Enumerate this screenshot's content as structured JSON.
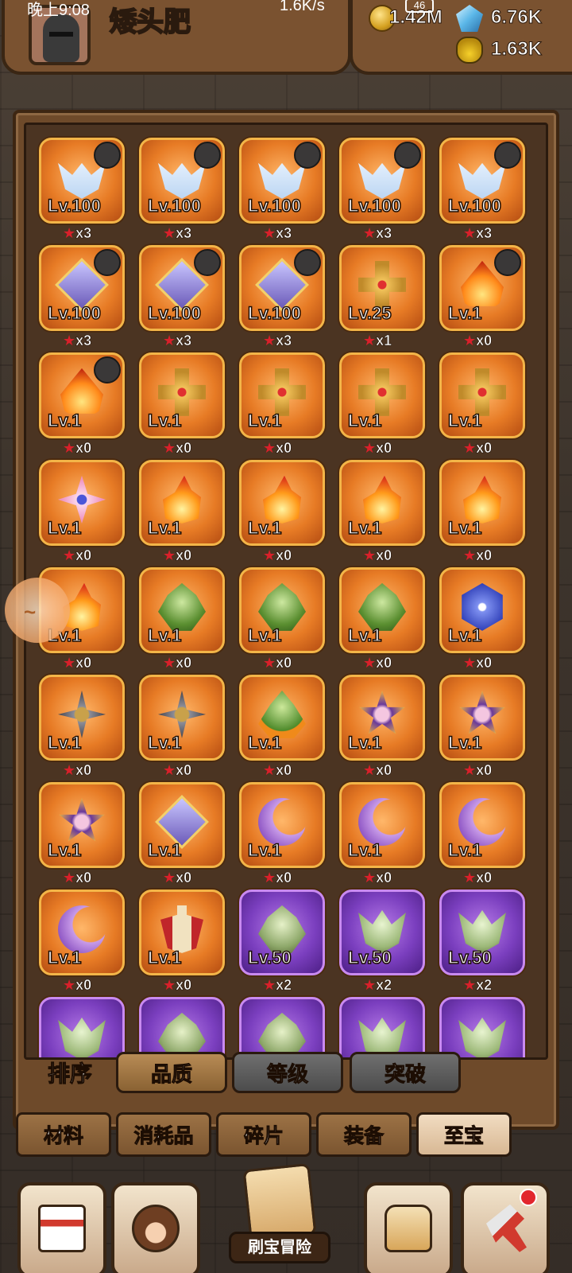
{
  "status": {
    "time": "晚上9:08",
    "net": "1.6K/s",
    "battery": "46"
  },
  "player": {
    "name": "矮头肥"
  },
  "currency": {
    "gold": "1.42M",
    "gems": "6.76K",
    "potion": "1.63K"
  },
  "items": [
    {
      "lv": "Lv.100",
      "stars": "x3",
      "icon": "wing",
      "portrait": true,
      "color": "orange"
    },
    {
      "lv": "Lv.100",
      "stars": "x3",
      "icon": "wing",
      "portrait": true,
      "color": "orange"
    },
    {
      "lv": "Lv.100",
      "stars": "x3",
      "icon": "wing",
      "portrait": true,
      "color": "orange"
    },
    {
      "lv": "Lv.100",
      "stars": "x3",
      "icon": "wing",
      "portrait": true,
      "color": "orange"
    },
    {
      "lv": "Lv.100",
      "stars": "x3",
      "icon": "wing",
      "portrait": true,
      "color": "orange"
    },
    {
      "lv": "Lv.100",
      "stars": "x3",
      "icon": "diamond",
      "portrait": true,
      "color": "orange"
    },
    {
      "lv": "Lv.100",
      "stars": "x3",
      "icon": "diamond",
      "portrait": true,
      "color": "orange"
    },
    {
      "lv": "Lv.100",
      "stars": "x3",
      "icon": "diamond",
      "portrait": true,
      "color": "orange"
    },
    {
      "lv": "Lv.25",
      "stars": "x1",
      "icon": "cross",
      "portrait": false,
      "color": "orange"
    },
    {
      "lv": "Lv.1",
      "stars": "x0",
      "icon": "flame",
      "portrait": true,
      "color": "orange"
    },
    {
      "lv": "Lv.1",
      "stars": "x0",
      "icon": "flame",
      "portrait": true,
      "color": "orange"
    },
    {
      "lv": "Lv.1",
      "stars": "x0",
      "icon": "cross",
      "portrait": false,
      "color": "orange"
    },
    {
      "lv": "Lv.1",
      "stars": "x0",
      "icon": "cross",
      "portrait": false,
      "color": "orange"
    },
    {
      "lv": "Lv.1",
      "stars": "x0",
      "icon": "cross",
      "portrait": false,
      "color": "orange"
    },
    {
      "lv": "Lv.1",
      "stars": "x0",
      "icon": "cross",
      "portrait": false,
      "color": "orange"
    },
    {
      "lv": "Lv.1",
      "stars": "x0",
      "icon": "flower",
      "portrait": false,
      "color": "orange"
    },
    {
      "lv": "Lv.1",
      "stars": "x0",
      "icon": "fire",
      "portrait": false,
      "color": "orange"
    },
    {
      "lv": "Lv.1",
      "stars": "x0",
      "icon": "fire",
      "portrait": false,
      "color": "orange"
    },
    {
      "lv": "Lv.1",
      "stars": "x0",
      "icon": "fire",
      "portrait": false,
      "color": "orange"
    },
    {
      "lv": "Lv.1",
      "stars": "x0",
      "icon": "fire",
      "portrait": false,
      "color": "orange"
    },
    {
      "lv": "Lv.1",
      "stars": "x0",
      "icon": "fire",
      "portrait": false,
      "color": "orange"
    },
    {
      "lv": "Lv.1",
      "stars": "x0",
      "icon": "leaf",
      "portrait": false,
      "color": "orange"
    },
    {
      "lv": "Lv.1",
      "stars": "x0",
      "icon": "leaf",
      "portrait": false,
      "color": "orange"
    },
    {
      "lv": "Lv.1",
      "stars": "x0",
      "icon": "leaf",
      "portrait": false,
      "color": "orange"
    },
    {
      "lv": "Lv.1",
      "stars": "x0",
      "icon": "snow",
      "portrait": false,
      "color": "orange"
    },
    {
      "lv": "Lv.1",
      "stars": "x0",
      "icon": "shuriken",
      "portrait": false,
      "color": "orange"
    },
    {
      "lv": "Lv.1",
      "stars": "x0",
      "icon": "shuriken",
      "portrait": false,
      "color": "orange"
    },
    {
      "lv": "Lv.1",
      "stars": "x0",
      "icon": "sprout",
      "portrait": false,
      "color": "orange"
    },
    {
      "lv": "Lv.1",
      "stars": "x0",
      "icon": "star",
      "portrait": false,
      "color": "orange"
    },
    {
      "lv": "Lv.1",
      "stars": "x0",
      "icon": "star",
      "portrait": false,
      "color": "orange"
    },
    {
      "lv": "Lv.1",
      "stars": "x0",
      "icon": "star",
      "portrait": false,
      "color": "orange"
    },
    {
      "lv": "Lv.1",
      "stars": "x0",
      "icon": "diamond",
      "portrait": false,
      "color": "orange"
    },
    {
      "lv": "Lv.1",
      "stars": "x0",
      "icon": "moon",
      "portrait": false,
      "color": "orange"
    },
    {
      "lv": "Lv.1",
      "stars": "x0",
      "icon": "moon",
      "portrait": false,
      "color": "orange"
    },
    {
      "lv": "Lv.1",
      "stars": "x0",
      "icon": "moon",
      "portrait": false,
      "color": "orange"
    },
    {
      "lv": "Lv.1",
      "stars": "x0",
      "icon": "moon",
      "portrait": false,
      "color": "orange"
    },
    {
      "lv": "Lv.1",
      "stars": "x0",
      "icon": "sword",
      "portrait": false,
      "color": "orange"
    },
    {
      "lv": "Lv.50",
      "stars": "x2",
      "icon": "pleaf",
      "portrait": false,
      "color": "purple"
    },
    {
      "lv": "Lv.50",
      "stars": "x2",
      "icon": "pwing",
      "portrait": false,
      "color": "purple"
    },
    {
      "lv": "Lv.50",
      "stars": "x2",
      "icon": "pwing",
      "portrait": false,
      "color": "purple"
    },
    {
      "lv": "",
      "stars": "",
      "icon": "pwing",
      "portrait": false,
      "color": "purple"
    },
    {
      "lv": "",
      "stars": "",
      "icon": "pleaf",
      "portrait": false,
      "color": "purple"
    },
    {
      "lv": "",
      "stars": "",
      "icon": "pleaf",
      "portrait": false,
      "color": "purple"
    },
    {
      "lv": "",
      "stars": "",
      "icon": "pwing",
      "portrait": false,
      "color": "purple"
    },
    {
      "lv": "",
      "stars": "",
      "icon": "pwing",
      "portrait": false,
      "color": "purple"
    }
  ],
  "sort": {
    "label": "排序",
    "options": [
      "品质",
      "等级",
      "突破"
    ],
    "selected": 0
  },
  "tabs": {
    "items": [
      "材料",
      "消耗品",
      "碎片",
      "装备",
      "至宝"
    ],
    "selected": 4
  },
  "bottom_nav": {
    "treasure_label": "刷宝冒险"
  }
}
